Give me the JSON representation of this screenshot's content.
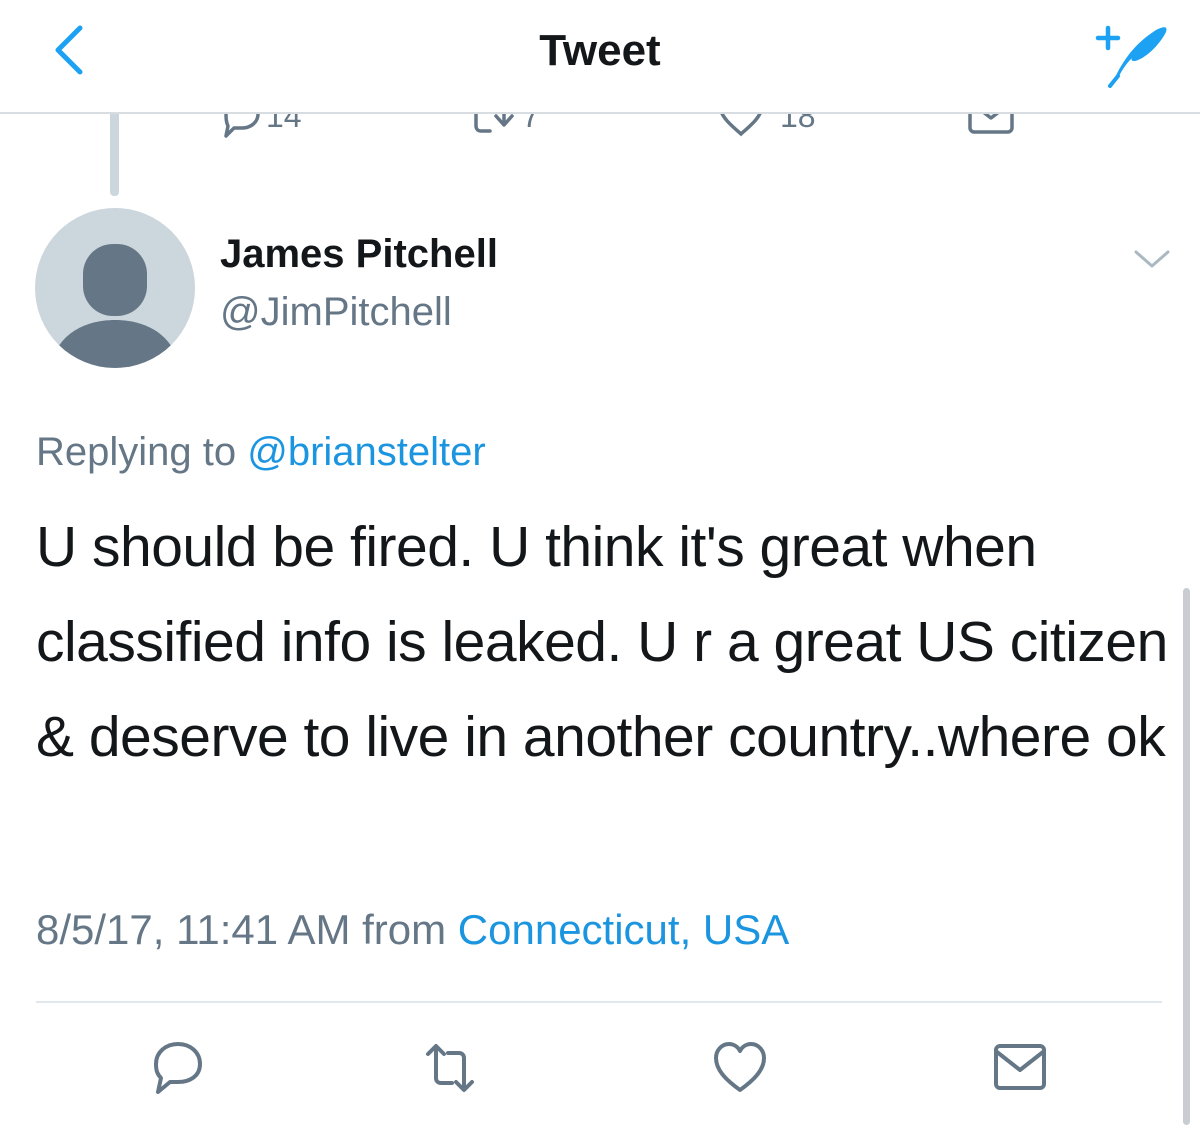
{
  "nav": {
    "title": "Tweet",
    "back_icon": "chevron-left-icon",
    "compose_icon": "compose-tweet-icon",
    "accent": "#1da1f2"
  },
  "previous_tweet": {
    "reply_count": "14",
    "retweet_count": "7",
    "like_count": "18"
  },
  "tweet": {
    "name": "James Pitchell",
    "handle": "@JimPitchell",
    "replying_prefix": "Replying to",
    "replying_to": "@brianstelter",
    "text": "U should be fired. U think it's great when classified info is leaked. U r a great US citizen & deserve to live in another country..where ok",
    "timestamp": "8/5/17, 11:41 AM",
    "from_prefix": "from",
    "location": "Connecticut, USA"
  },
  "colors": {
    "link": "#1b95e0",
    "secondary_text": "#657786",
    "icon": "#657786",
    "avatar_bg": "#ccd6dd",
    "avatar_fg": "#657786"
  },
  "actions": [
    {
      "name": "reply",
      "icon": "reply-icon"
    },
    {
      "name": "retweet",
      "icon": "retweet-icon"
    },
    {
      "name": "like",
      "icon": "heart-icon"
    },
    {
      "name": "share",
      "icon": "envelope-icon"
    }
  ]
}
